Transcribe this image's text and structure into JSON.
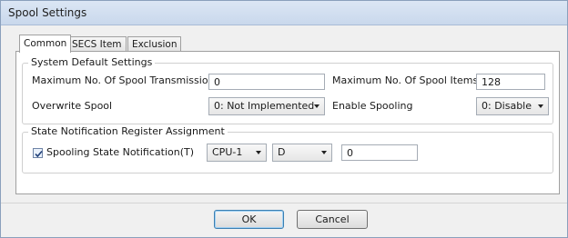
{
  "window": {
    "title": "Spool Settings"
  },
  "tabs": [
    {
      "label": "Common",
      "active": true
    },
    {
      "label": "SECS Item",
      "active": false
    },
    {
      "label": "Exclusion",
      "active": false
    }
  ],
  "system_defaults": {
    "legend": "System Default Settings",
    "max_spool_transmission_label": "Maximum No. Of Spool Transmission",
    "max_spool_transmission_value": "0",
    "max_spool_items_label": "Maximum No. Of Spool Items",
    "max_spool_items_value": "128",
    "overwrite_spool_label": "Overwrite Spool",
    "overwrite_spool_value": "0: Not Implemented",
    "enable_spooling_label": "Enable Spooling",
    "enable_spooling_value": "0: Disable"
  },
  "state_notification": {
    "legend": "State Notification Register Assignment",
    "checkbox_label": "Spooling State Notification(T)",
    "checked": true,
    "cpu_value": "CPU-1",
    "device_value": "D",
    "address_value": "0"
  },
  "buttons": {
    "ok_label": "OK",
    "cancel_label": "Cancel"
  },
  "colors": {
    "titlebar": "#c9d8ec",
    "default_button_border": "#3c7fb1",
    "check": "#1f3f78"
  }
}
